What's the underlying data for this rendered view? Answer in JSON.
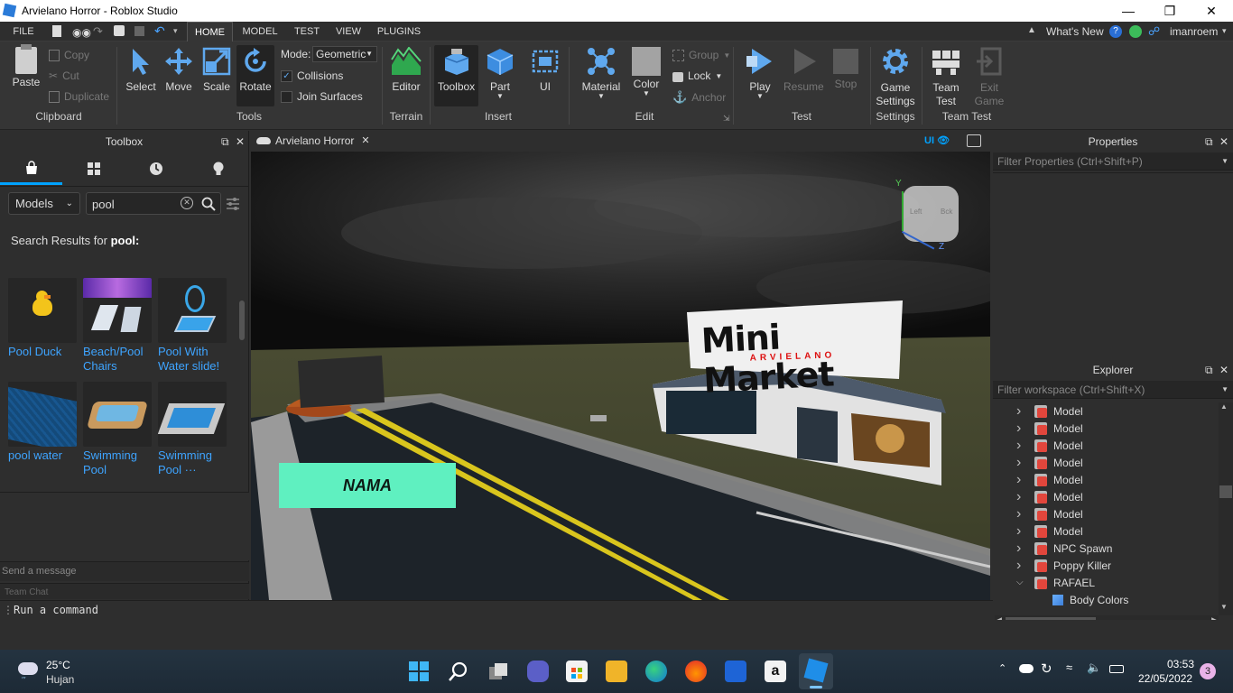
{
  "window": {
    "title": "Arvielano Horror - Roblox Studio"
  },
  "menu_tabs": [
    "FILE",
    "HOME",
    "MODEL",
    "TEST",
    "VIEW",
    "PLUGINS"
  ],
  "menu_right": {
    "whats_new": "What's New",
    "user": "imanroem"
  },
  "ribbon": {
    "clipboard": {
      "paste": "Paste",
      "copy": "Copy",
      "cut": "Cut",
      "duplicate": "Duplicate",
      "group": "Clipboard"
    },
    "tools": {
      "select": "Select",
      "move": "Move",
      "scale": "Scale",
      "rotate": "Rotate",
      "mode_label": "Mode:",
      "mode_value": "Geometric",
      "collisions": "Collisions",
      "join_surfaces": "Join Surfaces",
      "group": "Tools"
    },
    "terrain": {
      "editor": "Editor",
      "group": "Terrain"
    },
    "insert": {
      "toolbox": "Toolbox",
      "part": "Part",
      "ui": "UI",
      "group": "Insert"
    },
    "edit": {
      "material": "Material",
      "color": "Color",
      "group_btn": "Group",
      "lock": "Lock",
      "anchor": "Anchor",
      "group": "Edit"
    },
    "test": {
      "play": "Play",
      "resume": "Resume",
      "stop": "Stop",
      "group": "Test"
    },
    "settings": {
      "game_settings_1": "Game",
      "game_settings_2": "Settings",
      "group": "Settings"
    },
    "team_test": {
      "team_test_1": "Team",
      "team_test_2": "Test",
      "exit_game_1": "Exit",
      "exit_game_2": "Game",
      "group": "Team Test"
    }
  },
  "toolbox": {
    "title": "Toolbox",
    "category": "Models",
    "search_value": "pool",
    "results_prefix": "Search Results for",
    "results_query": "pool:",
    "items": [
      {
        "line1": "Pool Duck",
        "line2": ""
      },
      {
        "line1": "Beach/Pool",
        "line2": "Chairs"
      },
      {
        "line1": "Pool With",
        "line2": "Water slide!"
      },
      {
        "line1": "pool water",
        "line2": ""
      },
      {
        "line1": "Swimming",
        "line2": "Pool"
      },
      {
        "line1": "Swimming",
        "line2": "Pool ···"
      }
    ],
    "chat_placeholder": "Send a message",
    "team_chat": "Team Chat"
  },
  "doc_tab": {
    "title": "Arvielano Horror",
    "ui_toggle": "UI"
  },
  "viewport": {
    "sign_title": "Mini Market",
    "sign_subtitle": "ARVIELANO",
    "name_label": "NAMA",
    "cube_left": "Left",
    "cube_back": "Bck",
    "axis_y": "Y",
    "axis_z": "Z"
  },
  "properties": {
    "title": "Properties",
    "filter_placeholder": "Filter Properties (Ctrl+Shift+P)"
  },
  "explorer": {
    "title": "Explorer",
    "filter_placeholder": "Filter workspace (Ctrl+Shift+X)",
    "rows": [
      {
        "label": "Model",
        "expanded": false
      },
      {
        "label": "Model",
        "expanded": false
      },
      {
        "label": "Model",
        "expanded": false
      },
      {
        "label": "Model",
        "expanded": false
      },
      {
        "label": "Model",
        "expanded": false
      },
      {
        "label": "Model",
        "expanded": false
      },
      {
        "label": "Model",
        "expanded": false
      },
      {
        "label": "Model",
        "expanded": false
      },
      {
        "label": "NPC Spawn",
        "expanded": false
      },
      {
        "label": "Poppy Killer",
        "expanded": false
      },
      {
        "label": "RAFAEL",
        "expanded": true
      },
      {
        "label": "Body Colors",
        "expanded": false
      }
    ]
  },
  "command_bar": {
    "placeholder": "Run a command"
  },
  "taskbar": {
    "weather_temp": "25°C",
    "weather_desc": "Hujan",
    "time": "03:53",
    "date": "22/05/2022",
    "notification_count": "3"
  },
  "colors": {
    "accent": "#00a2ff",
    "link": "#3ea4ff",
    "name_label_bg": "#5ff0c0"
  }
}
